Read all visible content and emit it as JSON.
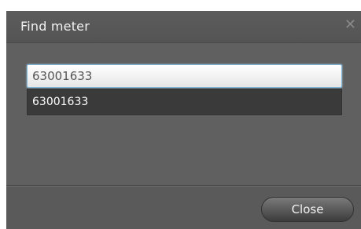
{
  "dialog": {
    "title": "Find meter",
    "close_icon": "close-icon",
    "close_glyph": "✕"
  },
  "search": {
    "value": "63001633",
    "placeholder": ""
  },
  "suggestions": [
    {
      "label": "63001633"
    }
  ],
  "footer": {
    "close_label": "Close"
  },
  "colors": {
    "dialog_background": "#5f5f5f",
    "suggestion_background": "#3a3a3a",
    "input_focus_border": "#7fb6d9"
  }
}
